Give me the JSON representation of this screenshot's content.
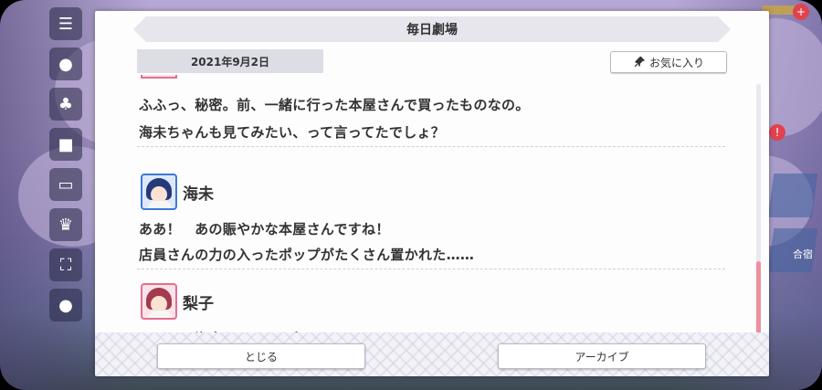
{
  "dialog": {
    "title": "毎日劇場",
    "date": "2021年9月2日",
    "favorite_label": "お気に入り"
  },
  "messages": [
    {
      "speaker": "",
      "lines": [
        "ふふっ、秘密。前、一緒に行った本屋さんで買ったものなの。",
        "海未ちゃんも見てみたい、って言ってたでしょ？"
      ]
    },
    {
      "speaker": "海未",
      "lines": [
        "ああ！　あの賑やかな本屋さんですね！",
        "店員さんの力の入ったポップがたくさん置かれた……"
      ]
    },
    {
      "speaker": "梨子",
      "lines": [
        "そう！　海未ちゃんにも気に入ってもらえるといいな！"
      ]
    }
  ],
  "footer": {
    "close_label": "とじる",
    "archive_label": "アーカイブ"
  },
  "scroll": {
    "position_fraction": 0.68,
    "thumb_fraction": 0.39
  },
  "colors": {
    "accent_pink": "#ef8f9f",
    "umi_frame": "#3f78d8",
    "riko_frame": "#e36f8e"
  },
  "background": {
    "alert_badge": "!",
    "plus_badge": "+",
    "side_label": "合宿"
  }
}
